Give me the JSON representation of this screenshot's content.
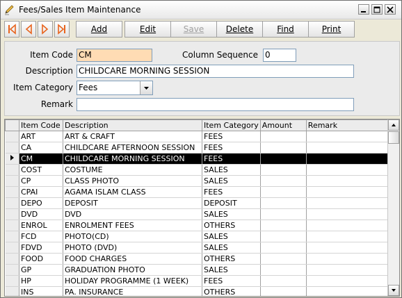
{
  "window": {
    "title": "Fees/Sales Item Maintenance"
  },
  "toolbar": {
    "add": "Add",
    "edit": "Edit",
    "save": "Save",
    "delete": "Delete",
    "find": "Find",
    "print": "Print"
  },
  "form": {
    "item_code_label": "Item Code",
    "item_code_value": "CM",
    "column_sequence_label": "Column Sequence",
    "column_sequence_value": "0",
    "description_label": "Description",
    "description_value": "CHILDCARE MORNING SESSION",
    "item_category_label": "Item Category",
    "item_category_value": "Fees",
    "remark_label": "Remark",
    "remark_value": ""
  },
  "grid": {
    "headers": [
      "Item Code",
      "Description",
      "Item Category",
      "Amount",
      "Remark"
    ],
    "selected_index": 2,
    "rows": [
      [
        "ART",
        "ART & CRAFT",
        "FEES",
        "",
        ""
      ],
      [
        "CA",
        "CHILDCARE AFTERNOON SESSION",
        "FEES",
        "",
        ""
      ],
      [
        "CM",
        "CHILDCARE MORNING SESSION",
        "FEES",
        "",
        ""
      ],
      [
        "COST",
        "COSTUME",
        "SALES",
        "",
        ""
      ],
      [
        "CP",
        "CLASS PHOTO",
        "SALES",
        "",
        ""
      ],
      [
        "CPAI",
        "AGAMA ISLAM CLASS",
        "FEES",
        "",
        ""
      ],
      [
        "DEPO",
        "DEPOSIT",
        "DEPOSIT",
        "",
        ""
      ],
      [
        "DVD",
        "DVD",
        "SALES",
        "",
        ""
      ],
      [
        "ENROL",
        "ENROLMENT FEES",
        "OTHERS",
        "",
        ""
      ],
      [
        "FCD",
        "PHOTO(CD)",
        "SALES",
        "",
        ""
      ],
      [
        "FDVD",
        "PHOTO (DVD)",
        "SALES",
        "",
        ""
      ],
      [
        "FOOD",
        "FOOD CHARGES",
        "OTHERS",
        "",
        ""
      ],
      [
        "GP",
        "GRADUATION PHOTO",
        "SALES",
        "",
        ""
      ],
      [
        "HP",
        "HOLIDAY PROGRAMME (1 WEEK)",
        "FEES",
        "",
        ""
      ],
      [
        "INS",
        "PA. INSURANCE",
        "OTHERS",
        "",
        ""
      ]
    ]
  },
  "icons": {
    "app": "pencil-icon",
    "nav": [
      "first-record-icon",
      "previous-record-icon",
      "next-record-icon",
      "last-record-icon"
    ],
    "row_indicator": "current-row-arrow-icon"
  },
  "colors": {
    "nav_arrow": "#e8641e",
    "active_field": "#ffdcb4",
    "selected_row": "#000000"
  }
}
